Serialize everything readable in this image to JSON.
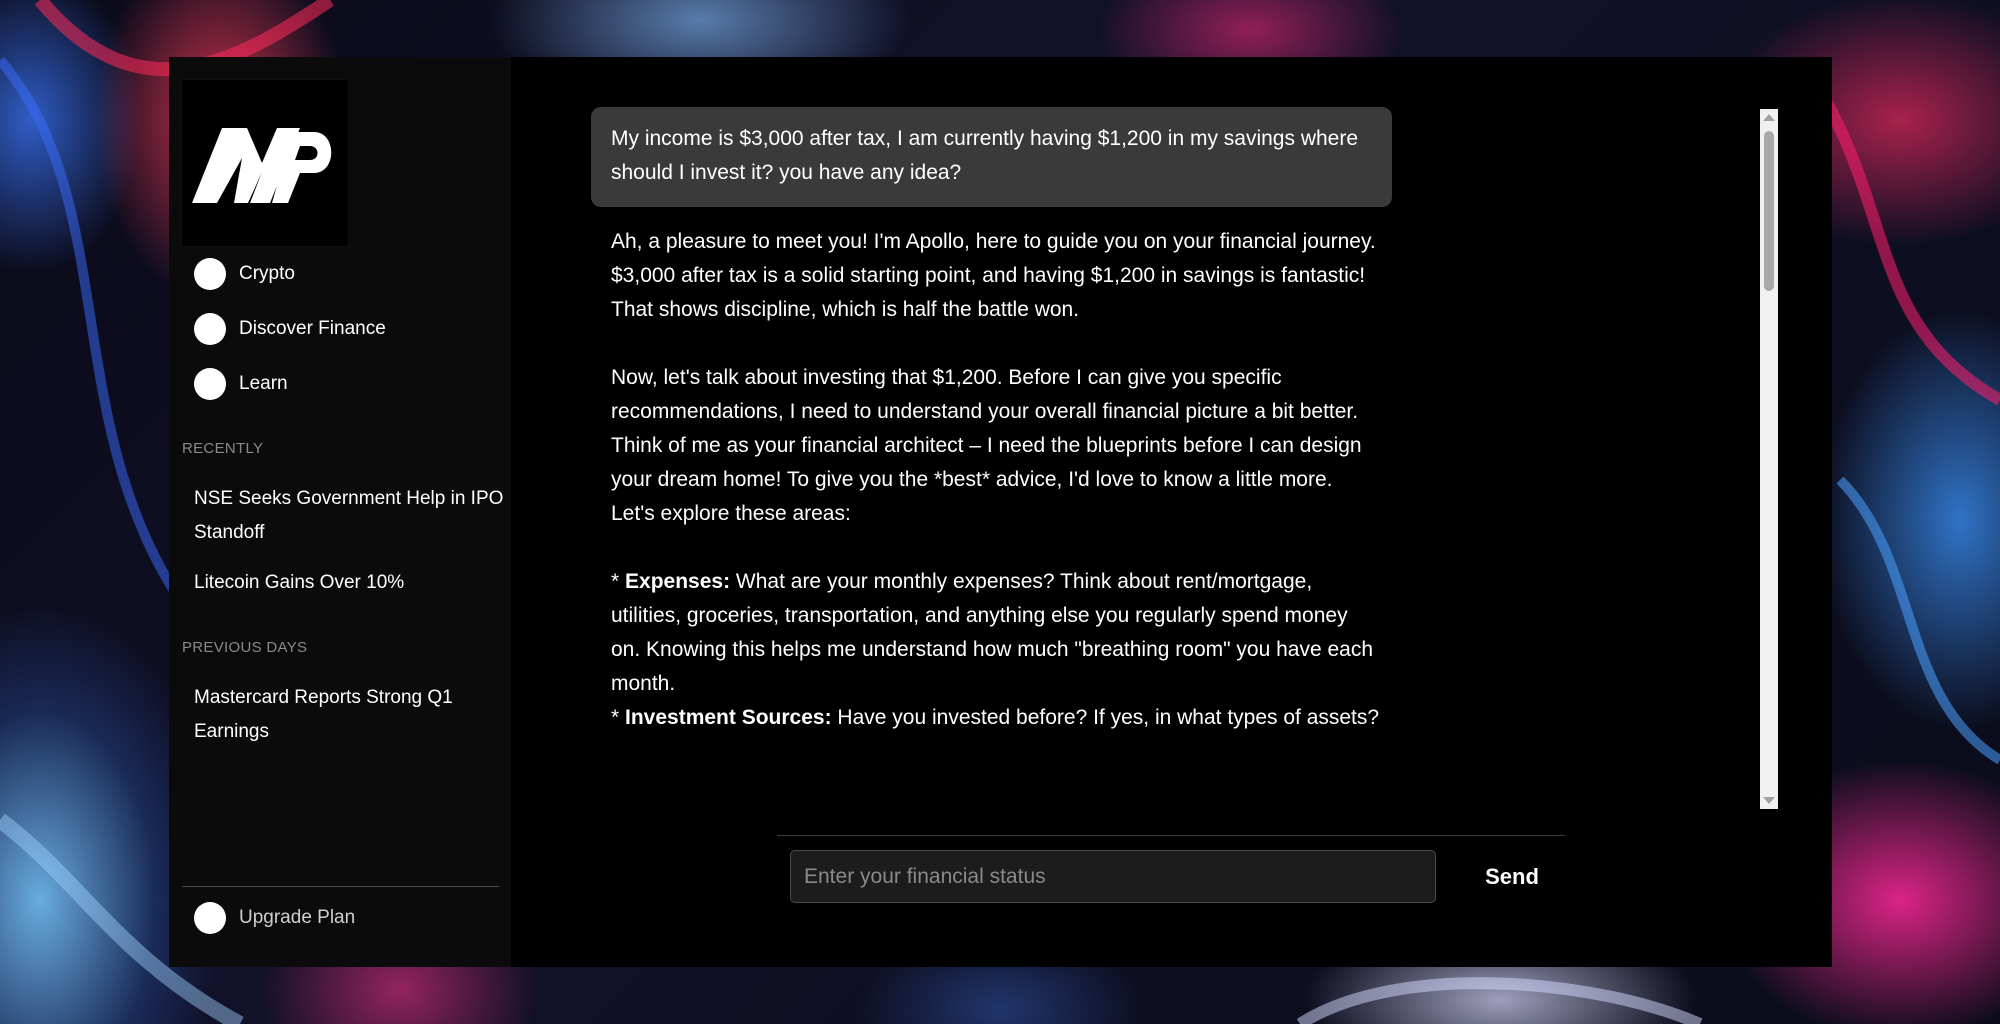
{
  "sidebar": {
    "logo_text": "MP",
    "nav": [
      {
        "label": "Crypto",
        "icon": "circle-icon"
      },
      {
        "label": "Discover Finance",
        "icon": "circle-icon"
      },
      {
        "label": "Learn",
        "icon": "circle-icon"
      }
    ],
    "recently_label": "RECENTLY",
    "recently": [
      {
        "title": "NSE Seeks Government Help in IPO Standoff"
      },
      {
        "title": "Litecoin Gains Over 10%"
      }
    ],
    "previous_label": "PREVIOUS DAYS",
    "previous": [
      {
        "title": "Mastercard Reports Strong Q1 Earnings"
      }
    ],
    "upgrade_label": "Upgrade Plan"
  },
  "chat": {
    "user_message": "My income is $3,000 after tax, I am currently having $1,200 in my savings where should I invest it? you have any idea?",
    "bot_p1": "Ah, a pleasure to meet you! I'm Apollo, here to guide you on your financial journey. $3,000 after tax is a solid starting point, and having $1,200 in savings is fantastic! That shows discipline, which is half the battle won.",
    "bot_p2": "Now, let's talk about investing that $1,200. Before I can give you specific recommendations, I need to understand your overall financial picture a bit better. Think of me as your financial architect – I need the blueprints before I can design your dream home! To give you the *best* advice, I'd love to know a little more. Let's explore these areas:",
    "bullet1_prefix": "* ",
    "bullet1_bold": "Expenses:",
    "bullet1_text": " What are your monthly expenses? Think about rent/mortgage, utilities, groceries, transportation, and anything else you regularly spend money on. Knowing this helps me understand how much \"breathing room\" you have each month.",
    "bullet2_prefix": "* ",
    "bullet2_bold": "Investment Sources:",
    "bullet2_text": " Have you invested before? If yes, in what types of assets?"
  },
  "input": {
    "placeholder": "Enter your financial status",
    "value": "",
    "send_label": "Send"
  },
  "colors": {
    "app_bg": "#000000",
    "sidebar_bg": "#0b0b0b",
    "user_bubble": "#3a3a3a",
    "section_label": "#8a8a8a"
  }
}
